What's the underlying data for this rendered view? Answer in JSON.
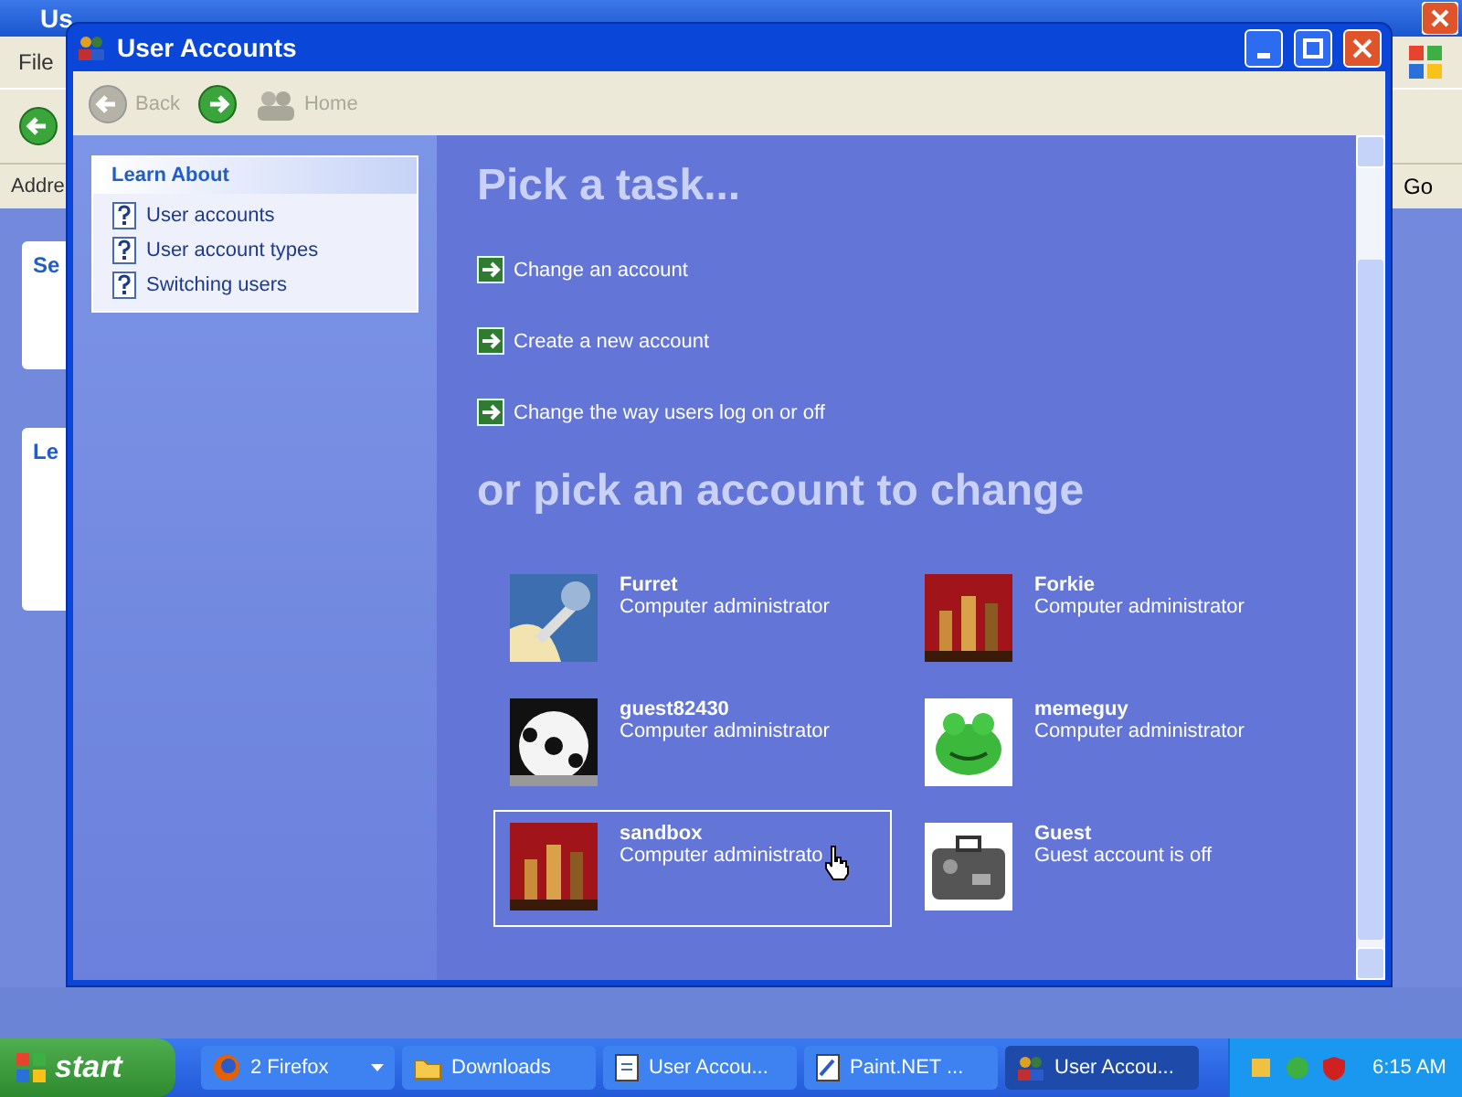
{
  "background_window": {
    "title": "Us",
    "menu": [
      "File"
    ],
    "address_label": "Addre",
    "go_button": "Go",
    "panels": [
      "Se",
      "Le"
    ]
  },
  "window": {
    "title": "User Accounts"
  },
  "toolbar": {
    "back": "Back",
    "home": "Home"
  },
  "learn_about": {
    "title": "Learn About",
    "items": [
      "User accounts",
      "User account types",
      "Switching users"
    ]
  },
  "tasks_heading": "Pick a task...",
  "tasks": [
    "Change an account",
    "Create a new account",
    "Change the way users log on or off"
  ],
  "accounts_heading": "or pick an account to change",
  "accounts": [
    {
      "name": "Furret",
      "type": "Computer administrator",
      "selected": false
    },
    {
      "name": "Forkie",
      "type": "Computer administrator",
      "selected": false
    },
    {
      "name": "guest82430",
      "type": "Computer administrator",
      "selected": false
    },
    {
      "name": "memeguy",
      "type": "Computer administrator",
      "selected": false
    },
    {
      "name": "sandbox",
      "type": "Computer administrato",
      "selected": true
    },
    {
      "name": "Guest",
      "type": "Guest account is off",
      "selected": false
    }
  ],
  "taskbar": {
    "start": "start",
    "buttons": [
      {
        "label": "2 Firefox",
        "selected": false,
        "kind": "group"
      },
      {
        "label": "Downloads",
        "selected": false,
        "kind": "folder"
      },
      {
        "label": "User Accou...",
        "selected": false,
        "kind": "doc"
      },
      {
        "label": "Paint.NET ...",
        "selected": false,
        "kind": "paint"
      },
      {
        "label": "User Accou...",
        "selected": true,
        "kind": "users"
      }
    ],
    "clock": "6:15 AM"
  }
}
